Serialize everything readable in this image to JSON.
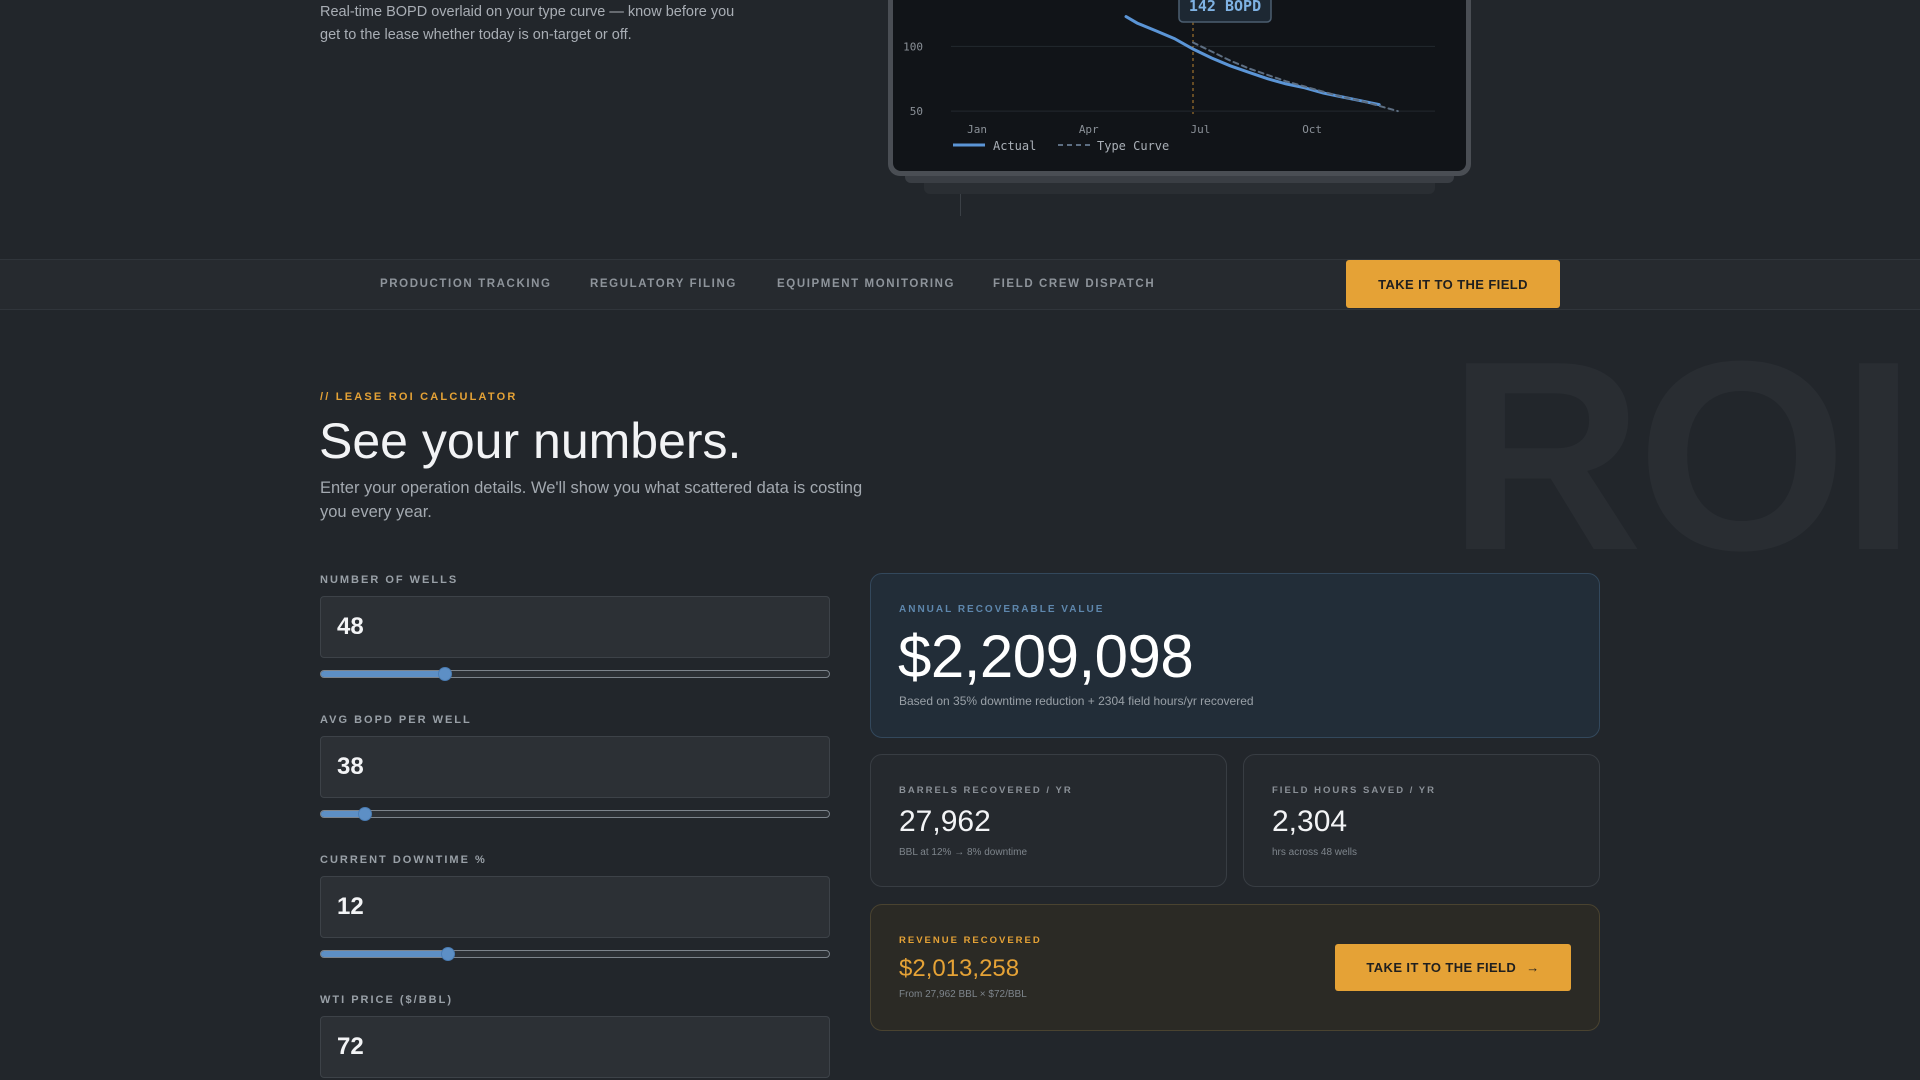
{
  "hero": {
    "description": "Real-time BOPD overlaid on your type curve — know before you get to the lease whether today is on-target or off."
  },
  "chart_data": {
    "type": "line",
    "title": "",
    "xlabel": "",
    "ylabel": "",
    "x_ticks": [
      "Jan",
      "Apr",
      "Jul",
      "Oct"
    ],
    "y_ticks": [
      50,
      100
    ],
    "series": [
      {
        "name": "Actual",
        "color": "#5b95d6",
        "style": "solid",
        "x": [
          5.2,
          5.5,
          6.0,
          6.5,
          7.0,
          7.5,
          8.0,
          8.5,
          9.0,
          9.5,
          10.0,
          10.5,
          11.0,
          11.5,
          12.0
        ],
        "y": [
          123,
          118,
          112,
          106,
          98,
          91,
          85,
          80,
          75,
          71,
          68,
          64,
          61,
          58,
          55
        ]
      },
      {
        "name": "Type Curve",
        "color": "#5d6e82",
        "style": "dashed",
        "x": [
          7.0,
          7.5,
          8.0,
          8.5,
          9.0,
          9.5,
          10.0,
          10.5,
          11.0,
          11.5,
          12.0,
          12.5
        ],
        "y": [
          103,
          96,
          89,
          83,
          78,
          73,
          69,
          65,
          61,
          58,
          54,
          50
        ]
      }
    ],
    "ylim": [
      30,
      125
    ],
    "xlim": [
      0.5,
      13.5
    ],
    "marker": {
      "x": 7.0,
      "label": "142 BOPD",
      "color": "#e5a236"
    },
    "grid": true,
    "legend": "bottom-left"
  },
  "nav": {
    "items": [
      "PRODUCTION TRACKING",
      "REGULATORY FILING",
      "EQUIPMENT MONITORING",
      "FIELD CREW DISPATCH"
    ],
    "cta": "TAKE IT TO THE FIELD"
  },
  "roi": {
    "bg_word": "ROI",
    "eyebrow": "// LEASE ROI CALCULATOR",
    "headline": "See your numbers.",
    "subhead": "Enter your operation details. We'll show you what scattered data is costing you every year.",
    "fields": [
      {
        "label": "NUMBER OF WELLS",
        "value": "48",
        "slider_fraction": 0.245
      },
      {
        "label": "AVG BOPD PER WELL",
        "value": "38",
        "slider_fraction": 0.087
      },
      {
        "label": "CURRENT DOWNTIME %",
        "value": "12",
        "slider_fraction": 0.25
      },
      {
        "label": "WTI PRICE ($/BBL)",
        "value": "72"
      }
    ]
  },
  "results": {
    "annual": {
      "label": "ANNUAL RECOVERABLE VALUE",
      "value": "$2,209,098",
      "note": "Based on 35% downtime reduction + 2304 field hours/yr recovered"
    },
    "barrels": {
      "label": "BARRELS RECOVERED / YR",
      "value": "27,962",
      "note": "BBL at 12% → 8% downtime"
    },
    "hours": {
      "label": "FIELD HOURS SAVED / YR",
      "value": "2,304",
      "note": "hrs across 48 wells"
    },
    "revenue": {
      "label": "REVENUE RECOVERED",
      "value": "$2,013,258",
      "note": "From 27,962 BBL × $72/BBL",
      "cta": "TAKE IT TO THE FIELD",
      "cta_arrow": "→"
    }
  },
  "colors": {
    "accent": "#e5a236",
    "blue": "#5d8fc5",
    "label_blue": "#5e87ad",
    "background": "#22262b"
  }
}
